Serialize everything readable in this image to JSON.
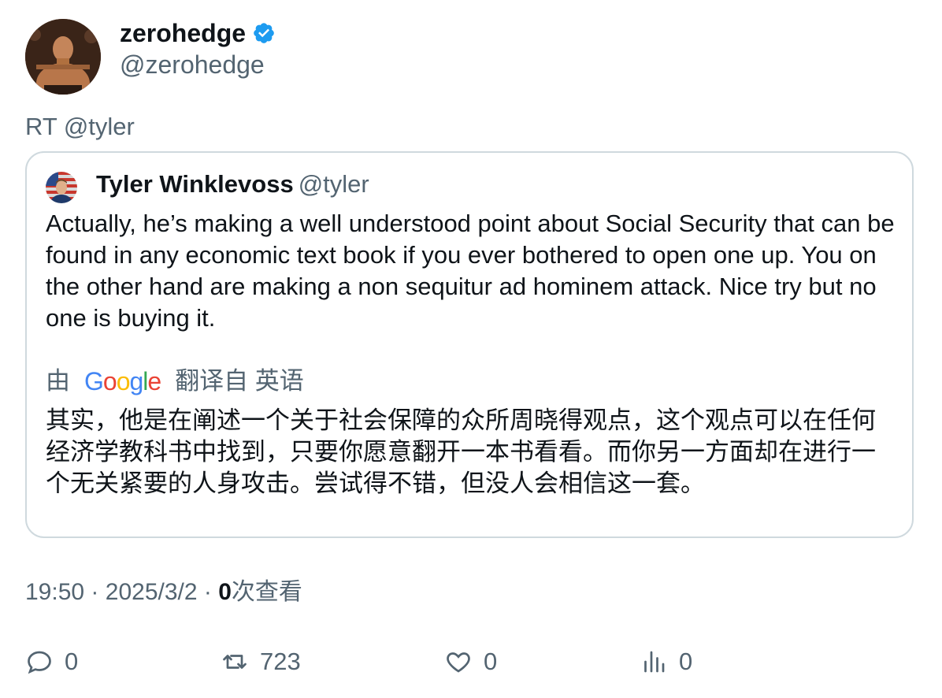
{
  "author": {
    "display_name": "zerohedge",
    "handle": "@zerohedge",
    "verified_icon": "verified-badge-icon"
  },
  "retweet_prefix": "RT @tyler",
  "quoted": {
    "display_name": "Tyler Winklevoss",
    "handle": "@tyler",
    "text": "Actually, he’s making a well understood point about Social Security that can be found in any economic text book if you ever bothered to open one up. You on the other hand are making a non sequitur ad hominem attack. Nice try but no one is buying it.",
    "translation_by": "由",
    "translation_from": "翻译自 英语",
    "translated_text": "其实，他是在阐述一个关于社会保障的众所周晓得观点，这个观点可以在任何经济学教科书中找到，只要你愿意翻开一本书看看。而你另一方面却在进行一个无关紧要的人身攻击。尝试得不错，但没人会相信这一套。"
  },
  "meta": {
    "time": "19:50",
    "separator": "·",
    "date": "2025/3/2",
    "views_count": "0",
    "views_label": "次查看"
  },
  "actions": {
    "replies": "0",
    "retweets": "723",
    "likes": "0",
    "views": "0"
  },
  "colors": {
    "text": "#0f1419",
    "secondary": "#536471",
    "border": "#cfd9de",
    "verified": "#1d9bf0"
  }
}
